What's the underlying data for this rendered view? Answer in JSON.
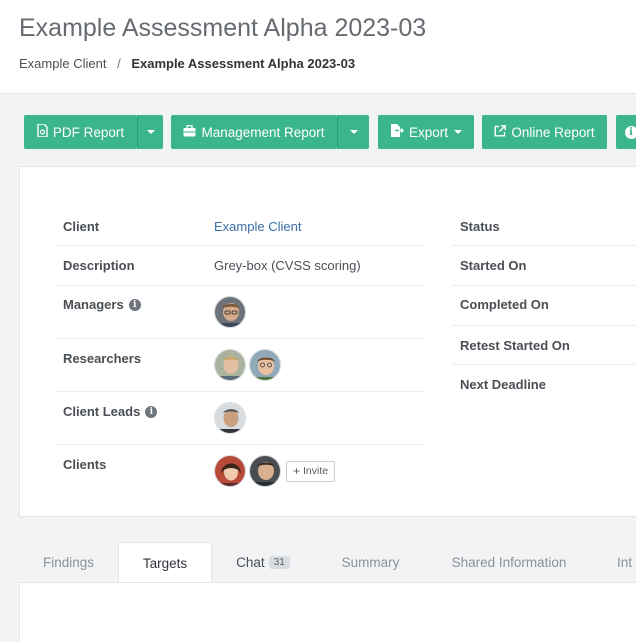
{
  "header": {
    "title": "Example Assessment Alpha 2023-03",
    "breadcrumb": {
      "parent": "Example Client",
      "separator": "/",
      "current": "Example Assessment Alpha 2023-03"
    }
  },
  "toolbar": {
    "pdf_report": "PDF Report",
    "management_report": "Management Report",
    "export": "Export",
    "online_report": "Online Report"
  },
  "details": {
    "client_label": "Client",
    "client_value": "Example Client",
    "description_label": "Description",
    "description_value": "Grey-box (CVSS scoring)",
    "managers_label": "Managers",
    "researchers_label": "Researchers",
    "client_leads_label": "Client Leads",
    "clients_label": "Clients",
    "invite_label": "Invite"
  },
  "status": {
    "status_label": "Status",
    "started_on_label": "Started On",
    "completed_on_label": "Completed On",
    "retest_started_on_label": "Retest Started On",
    "next_deadline_label": "Next Deadline"
  },
  "tabs": {
    "findings": "Findings",
    "targets": "Targets",
    "chat": "Chat",
    "chat_count": "31",
    "summary": "Summary",
    "shared_information": "Shared Information",
    "next_tab_partial": "Int"
  },
  "colors": {
    "accent": "#3bb58c",
    "link": "#3a6fa7"
  }
}
